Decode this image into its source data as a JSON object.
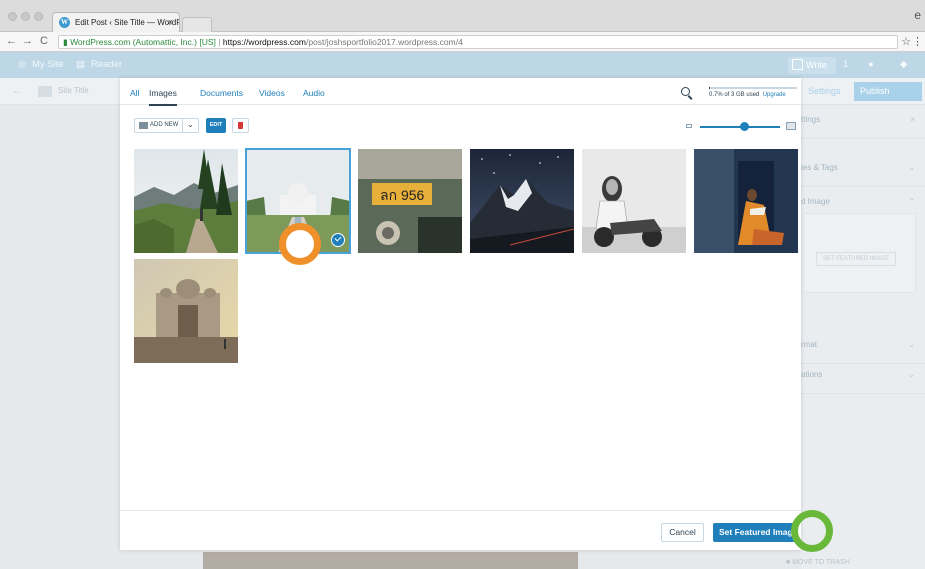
{
  "browser": {
    "tab_title": "Edit Post ‹ Site Title — WordP",
    "tab_close": "×",
    "url_secure_label": "WordPress.com (Automattic, Inc.) [US]",
    "url_host": "https://wordpress.com",
    "url_path": "/post/joshsportfolio2017.wordpress.com/4",
    "nav_back": "←",
    "nav_forward": "→",
    "nav_reload": "C",
    "star": "☆"
  },
  "masterbar": {
    "my_site": "My Site",
    "reader": "Reader",
    "write": "Write"
  },
  "editor_bg": {
    "site_title": "Site Title",
    "settings": "Settings",
    "publish": "Publish",
    "settings_row": "ttings",
    "categories_row": "ies & Tags",
    "featured_row": "d Image",
    "set_featured_image": "SET FEATURED IMAGE",
    "format_row": "rmat",
    "locations_row": "ations",
    "move_to_trash": "MOVE TO TRASH"
  },
  "modal": {
    "tabs": [
      "All",
      "Images",
      "Documents",
      "Videos",
      "Audio"
    ],
    "active_tab": "Images",
    "storage_text": "0.7% of 3 GB used",
    "storage_fraction": 0.007,
    "upgrade": "Upgrade",
    "add_new": "ADD NEW",
    "edit": "EDIT",
    "zoom_level": 0.55,
    "images": [
      {
        "name": "mountain-trail",
        "selected": false
      },
      {
        "name": "taj-mahal",
        "selected": true
      },
      {
        "name": "license-plate",
        "selected": false
      },
      {
        "name": "mountain-night",
        "selected": false
      },
      {
        "name": "motorcycle-man",
        "selected": false
      },
      {
        "name": "woman-reading",
        "selected": false
      },
      {
        "name": "mosque-haze",
        "selected": false
      }
    ],
    "cancel": "Cancel",
    "set_featured_image": "Set Featured Image"
  },
  "colors": {
    "accent": "#1f7fba",
    "orange_marker": "#f0902a",
    "green_marker": "#69b83a"
  }
}
